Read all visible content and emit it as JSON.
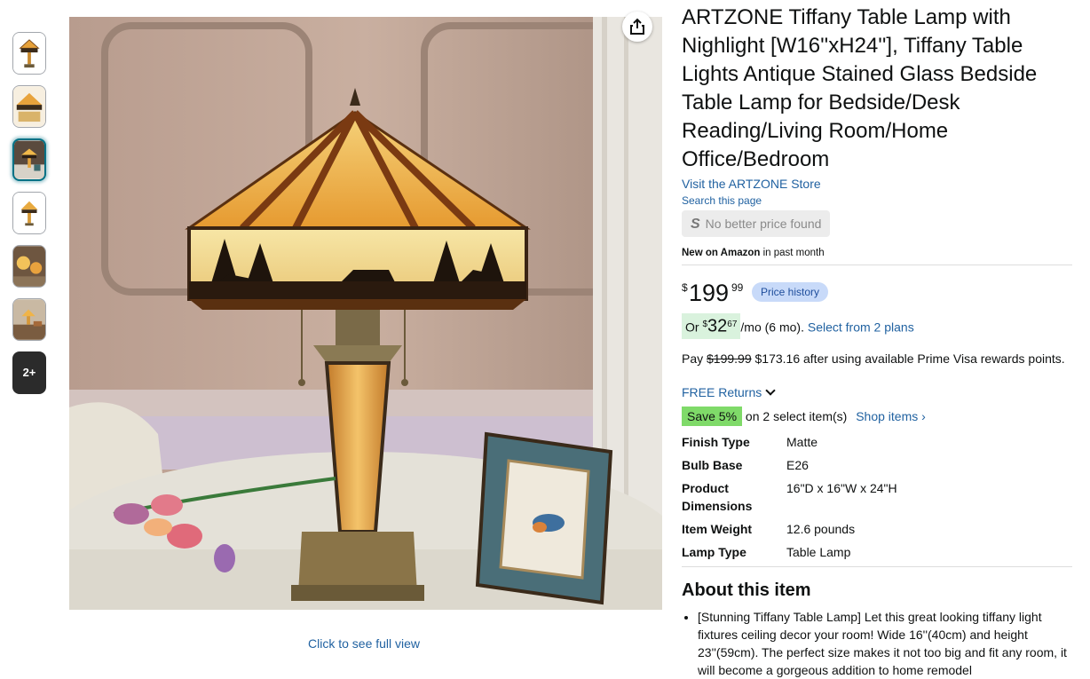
{
  "thumbnails": [
    {
      "name": "thumb-1",
      "selected": false
    },
    {
      "name": "thumb-2",
      "selected": false
    },
    {
      "name": "thumb-3",
      "selected": true
    },
    {
      "name": "thumb-4",
      "selected": false
    },
    {
      "name": "thumb-5",
      "selected": false
    },
    {
      "name": "thumb-6",
      "selected": false
    }
  ],
  "more_thumbs_label": "2+",
  "full_view_link": "Click to see full view",
  "product": {
    "title": "ARTZONE Tiffany Table Lamp with Nighlight [W16''xH24''], Tiffany Table Lights Antique Stained Glass Bedside Table Lamp for Bedside/Desk Reading/Living Room/Home Office/Bedroom",
    "store_link": "Visit the ARTZONE Store",
    "search_page": "Search this page",
    "no_better_price": "No better price found",
    "new_on_bold": "New on Amazon",
    "new_on_rest": " in past month",
    "price_symbol": "$",
    "price_whole": "199",
    "price_fraction": "99",
    "price_history": "Price history",
    "monthly_or": "Or ",
    "monthly_symbol": "$",
    "monthly_whole": "32",
    "monthly_fraction": "67",
    "monthly_suffix": "/mo (6 mo). ",
    "monthly_link": "Select from 2 plans",
    "pay_prefix": "Pay ",
    "pay_strike": "$199.99",
    "pay_rest": " $173.16 after using available Prime Visa rewards points.",
    "free_returns": "FREE Returns",
    "save_badge": "Save 5%",
    "save_text": " on 2 select item(s) ",
    "shop_items": "Shop items ›"
  },
  "specs": [
    {
      "key": "Finish Type",
      "value": "Matte"
    },
    {
      "key": "Bulb Base",
      "value": "E26"
    },
    {
      "key": "Product Dimensions",
      "value": "16\"D x 16\"W x 24\"H"
    },
    {
      "key": "Item Weight",
      "value": "12.6 pounds"
    },
    {
      "key": "Lamp Type",
      "value": "Table Lamp"
    }
  ],
  "about_heading": "About this item",
  "bullets": [
    "[Stunning Tiffany Table Lamp] Let this great looking tiffany light fixtures ceiling decor your room! Wide 16''(40cm) and height 23''(59cm). The perfect size makes it not too big and fit any room, it will become a gorgeous addition to home remodel"
  ],
  "colors": {
    "link": "#2162a1",
    "selected_thumb_border": "#007185",
    "price_history_bg": "#c8daf9",
    "save_badge_bg": "#7fda69",
    "monthly_bg": "#d9f2dd"
  },
  "icons": {
    "share": "share-icon",
    "chevron": "chevron-down-icon",
    "no_better_price": "s-logo-icon"
  }
}
